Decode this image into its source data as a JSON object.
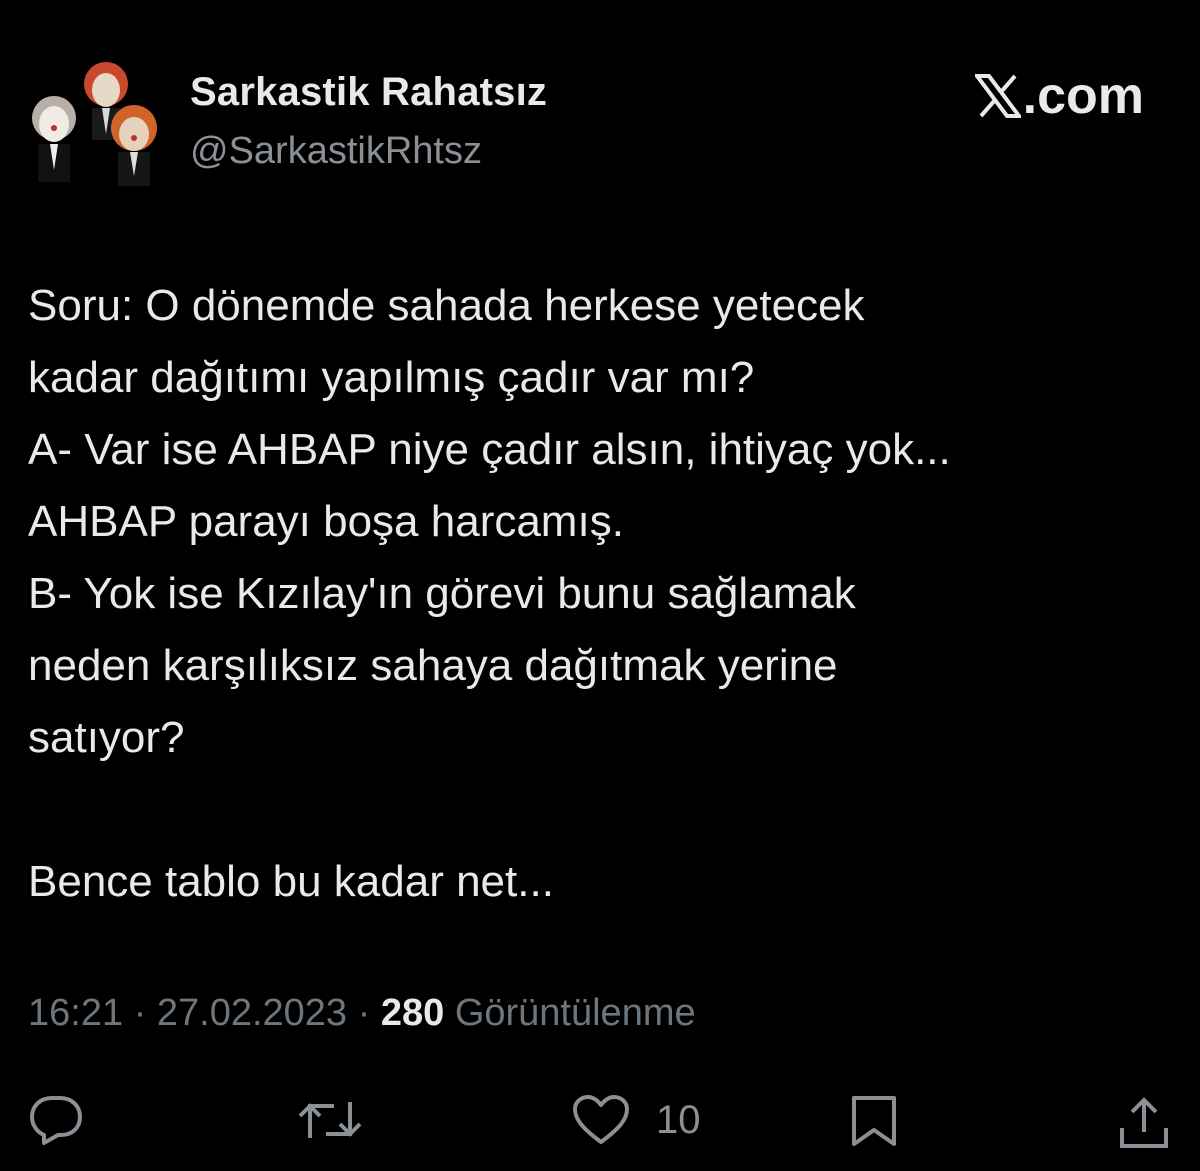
{
  "profile": {
    "display_name": "Sarkastik Rahatsız",
    "handle": "@SarkastikRhtsz"
  },
  "brand": {
    "label": ".com",
    "icon": "x-logo-icon"
  },
  "tweet": {
    "lines": [
      "Soru: O dönemde sahada herkese yetecek",
      "kadar dağıtımı yapılmış çadır var mı?",
      "A- Var ise AHBAP niye çadır alsın, ihtiyaç yok...",
      "AHBAP parayı boşa harcamış.",
      "B- Yok ise Kızılay'ın görevi bunu sağlamak",
      "neden karşılıksız sahaya dağıtmak yerine",
      "satıyor?",
      "",
      "Bence tablo bu kadar net..."
    ]
  },
  "meta": {
    "time": "16:21",
    "separator": " · ",
    "date": "27.02.2023",
    "views_count": "280",
    "views_label": "Görüntülenme"
  },
  "actions": {
    "reply_icon": "reply-icon",
    "retweet_icon": "retweet-icon",
    "like_icon": "heart-icon",
    "like_count": "10",
    "bookmark_icon": "bookmark-icon",
    "share_icon": "share-icon"
  },
  "colors": {
    "background": "#000000",
    "text_primary": "#e7e9ea",
    "text_secondary": "#6e767d"
  }
}
